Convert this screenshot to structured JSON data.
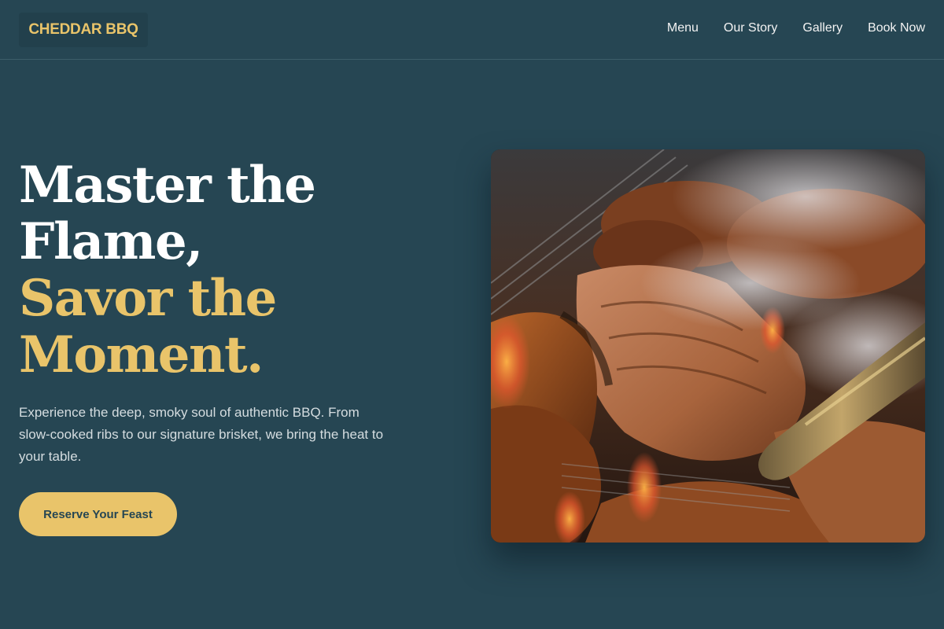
{
  "header": {
    "logo": "CHEDDAR BBQ",
    "nav": [
      "Menu",
      "Our Story",
      "Gallery",
      "Book Now"
    ]
  },
  "hero": {
    "title_lines": [
      "Master the",
      "Flame,"
    ],
    "accent_lines": [
      "Savor the",
      "Moment."
    ],
    "description": "Experience the deep, smoky soul of authentic BBQ. From slow-cooked ribs to our signature brisket, we bring the heat to your table.",
    "cta_label": "Reserve Your Feast",
    "image_icon": "grilled-meat-photo"
  },
  "colors": {
    "background": "#264653",
    "accent": "#e9c46a",
    "text": "#ffffff"
  }
}
